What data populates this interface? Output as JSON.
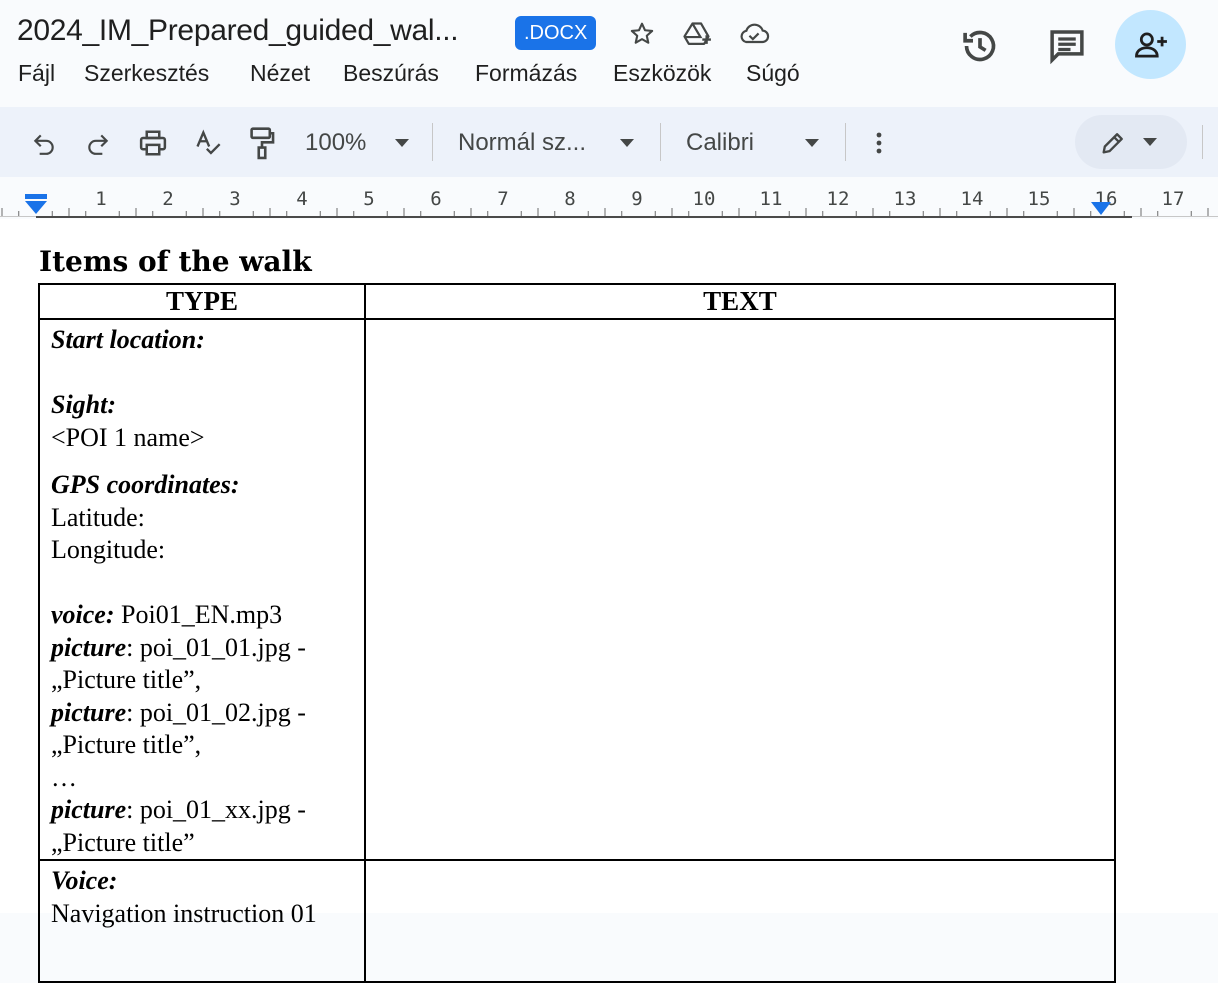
{
  "header": {
    "title": "2024_IM_Prepared_guided_wal...",
    "badge": ".DOCX",
    "icons": [
      "star-icon",
      "move-to-drive-icon",
      "cloud-saved-icon",
      "version-history-icon",
      "comments-icon",
      "share-add-person-icon"
    ]
  },
  "menu": {
    "items": [
      "Fájl",
      "Szerkesztés",
      "Nézet",
      "Beszúrás",
      "Formázás",
      "Eszközök",
      "Súgó"
    ]
  },
  "toolbar": {
    "zoom": "100%",
    "style": "Normál sz...",
    "font": "Calibri",
    "icons": [
      "undo-icon",
      "redo-icon",
      "print-icon",
      "spellcheck-icon",
      "paint-format-icon",
      "chevron-down-icon",
      "more-vert-icon",
      "pencil-icon"
    ]
  },
  "ruler": {
    "numbers": [
      "1",
      "2",
      "3",
      "4",
      "5",
      "6",
      "7",
      "8",
      "9",
      "10",
      "11",
      "12",
      "13",
      "14",
      "15",
      "16",
      "17"
    ]
  },
  "document": {
    "heading": "Items of the walk",
    "table": {
      "headers": [
        "TYPE",
        "TEXT"
      ],
      "row1": {
        "start_location": "Start location:",
        "sight_label": "Sight:",
        "poi_name": "<POI 1 name>",
        "gps_label": "GPS coordinates:",
        "latitude": "Latitude:",
        "longitude": "Longitude:",
        "voice_label": "voice:",
        "voice_value": " Poi01_EN.mp3",
        "picture_label": "picture",
        "pic1_file": ": poi_01_01.jpg -",
        "pic1_title": "„Picture title”,",
        "pic2_file": ": poi_01_02.jpg -",
        "pic2_title": "„Picture title”,",
        "ellipsis": "…",
        "pic3_file": ": poi_01_xx.jpg -",
        "pic3_title": "„Picture title”"
      },
      "row2": {
        "voice_label": "Voice:",
        "nav_instruction": "Navigation instruction 01"
      }
    }
  },
  "colors": {
    "badge": "#1a73e8",
    "share_button": "#c2e7ff",
    "toolbar_bg": "#edf2fa",
    "ruler_marker": "#1a73e8"
  }
}
